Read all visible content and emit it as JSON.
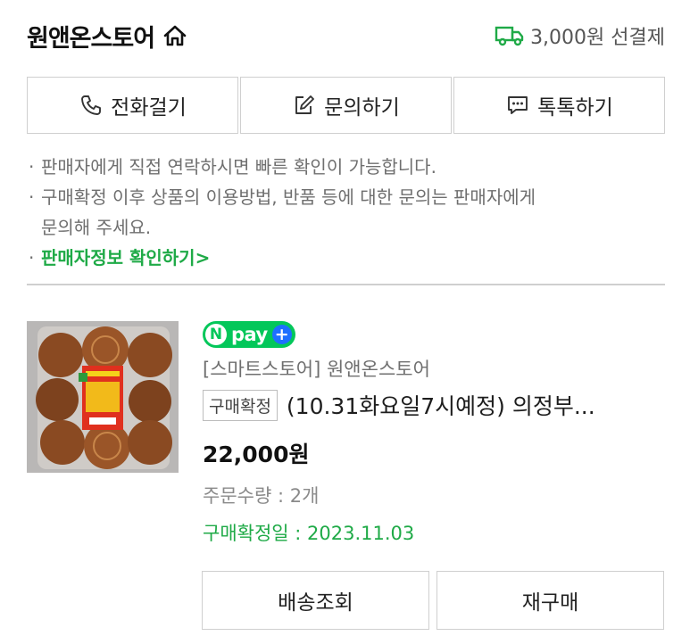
{
  "store": {
    "name": "원앤온스토어",
    "shipping_text": "3,000원 선결제"
  },
  "actions": {
    "call_label": "전화걸기",
    "inquiry_label": "문의하기",
    "talk_label": "톡톡하기"
  },
  "notice": {
    "line1": "판매자에게 직접 연락하시면 빠른 확인이 가능합니다.",
    "line2a": "구매확정 이후 상품의 이용방법, 반품 등에 대한 문의는 판매자에게",
    "line2b": "문의해 주세요.",
    "link": "판매자정보 확인하기",
    "link_arrow": ">"
  },
  "order": {
    "npay_n": "N",
    "npay_label": "pay",
    "npay_plus": "+",
    "store_line": "[스마트스토어] 원앤온스토어",
    "status_badge": "구매확정",
    "product_title": "(10.31화요일7시예정) 의정부...",
    "price": "22,000원",
    "quantity": "주문수량 : 2개",
    "confirm_date": "구매확정일 : 2023.11.03"
  },
  "buttons": {
    "track_label": "배송조회",
    "reorder_label": "재구매"
  },
  "colors": {
    "accent_green": "#1faa47",
    "npay_green": "#03c75a",
    "npay_blue": "#1e6fff",
    "border": "#cfcfcf"
  },
  "icons": {
    "home": "home-icon",
    "truck": "truck-icon",
    "phone": "phone-icon",
    "edit": "edit-icon",
    "chat": "chat-icon"
  }
}
